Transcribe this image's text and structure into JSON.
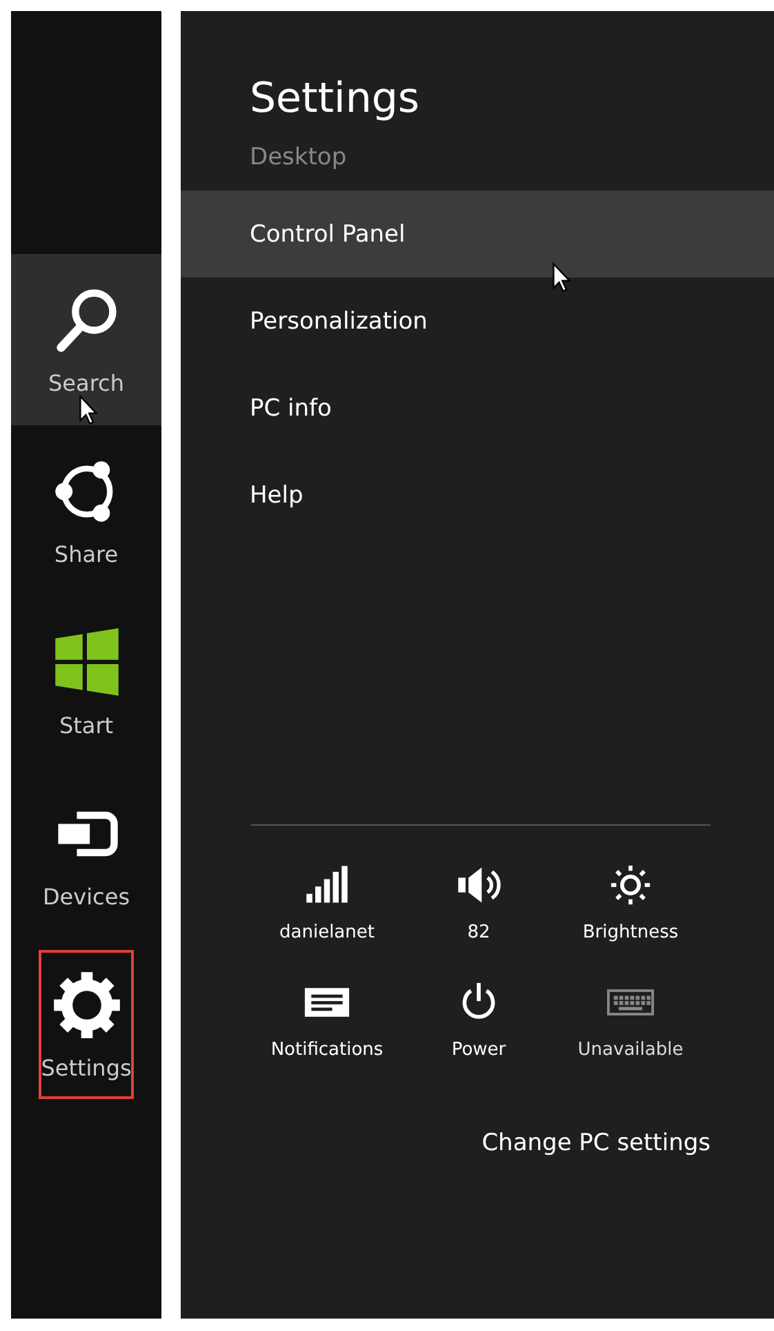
{
  "charms": [
    {
      "label": "Search",
      "kind": "search",
      "highlighted": true,
      "selected": false
    },
    {
      "label": "Share",
      "kind": "share",
      "highlighted": false,
      "selected": false
    },
    {
      "label": "Start",
      "kind": "start",
      "highlighted": false,
      "selected": false
    },
    {
      "label": "Devices",
      "kind": "devices",
      "highlighted": false,
      "selected": false
    },
    {
      "label": "Settings",
      "kind": "settings",
      "highlighted": false,
      "selected": true
    }
  ],
  "panel": {
    "title": "Settings",
    "subtitle": "Desktop",
    "items": [
      {
        "label": "Control Panel",
        "highlighted": true
      },
      {
        "label": "Personalization",
        "highlighted": false
      },
      {
        "label": "PC info",
        "highlighted": false
      },
      {
        "label": "Help",
        "highlighted": false
      }
    ],
    "quick_settings": [
      {
        "label": "danielanet",
        "kind": "network",
        "disabled": false
      },
      {
        "label": "82",
        "kind": "volume",
        "disabled": false
      },
      {
        "label": "Brightness",
        "kind": "brightness",
        "disabled": false
      },
      {
        "label": "Notifications",
        "kind": "notifications",
        "disabled": false
      },
      {
        "label": "Power",
        "kind": "power",
        "disabled": false
      },
      {
        "label": "Unavailable",
        "kind": "keyboard",
        "disabled": true
      }
    ],
    "footer_link": "Change PC settings"
  }
}
